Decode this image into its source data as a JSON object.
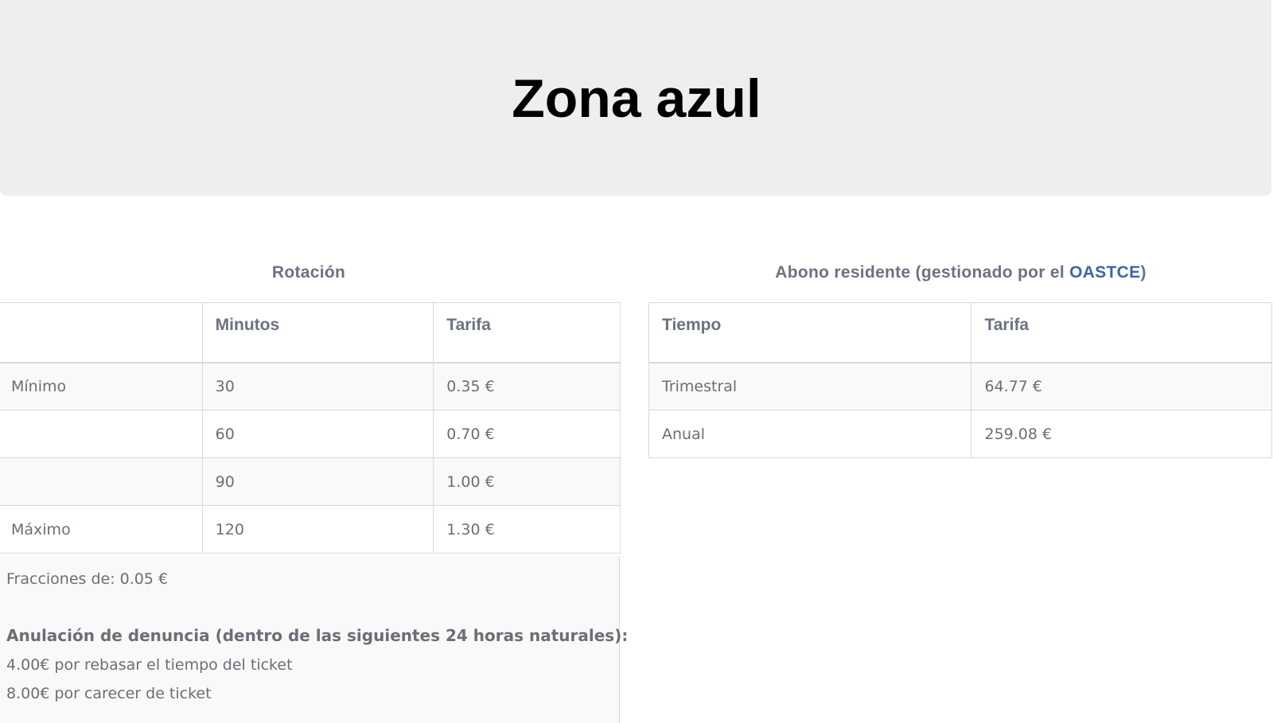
{
  "header": {
    "title": "Zona azul"
  },
  "rotacion": {
    "title": "Rotación",
    "columns": [
      "",
      "Minutos",
      "Tarifa"
    ],
    "rows": [
      {
        "label": "Mínimo",
        "minutos": "30",
        "tarifa": "0.35 €"
      },
      {
        "label": "",
        "minutos": "60",
        "tarifa": "0.70 €"
      },
      {
        "label": "",
        "minutos": "90",
        "tarifa": "1.00 €"
      },
      {
        "label": "Máximo",
        "minutos": "120",
        "tarifa": "1.30 €"
      }
    ],
    "fracciones": "Fracciones de: 0.05 €",
    "anulacion": {
      "title": "Anulación de denuncia (dentro de las siguientes 24 horas naturales):",
      "items": [
        "4.00€ por rebasar el tiempo del ticket",
        "8.00€ por carecer de ticket"
      ]
    }
  },
  "abono": {
    "title_prefix": "Abono residente (gestionado por el ",
    "title_link": "OASTCE",
    "title_suffix": ")",
    "columns": [
      "Tiempo",
      "Tarifa"
    ],
    "rows": [
      {
        "tiempo": "Trimestral",
        "tarifa": "64.77 €"
      },
      {
        "tiempo": "Anual",
        "tarifa": "259.08 €"
      }
    ]
  },
  "colors": {
    "header_bg": "#eeeeee",
    "text": "#6b6e75",
    "link": "#3a67a8",
    "row_alt": "#f9f9f9",
    "border": "#d7d9dc"
  }
}
